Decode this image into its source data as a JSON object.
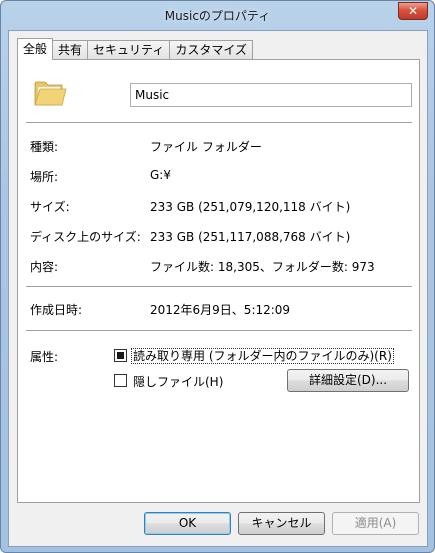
{
  "window": {
    "title": "Musicのプロパティ",
    "close_label": "✕"
  },
  "tabs": [
    {
      "label": "全般",
      "active": true
    },
    {
      "label": "共有",
      "active": false
    },
    {
      "label": "セキュリティ",
      "active": false
    },
    {
      "label": "カスタマイズ",
      "active": false
    }
  ],
  "general": {
    "name_value": "Music",
    "fields": {
      "type_label": "種類:",
      "type_value": "ファイル フォルダー",
      "location_label": "場所:",
      "location_value": "G:¥",
      "size_label": "サイズ:",
      "size_value": "233 GB (251,079,120,118 バイト)",
      "disk_size_label": "ディスク上のサイズ:",
      "disk_size_value": "233 GB (251,117,088,768 バイト)",
      "contents_label": "内容:",
      "contents_value": "ファイル数: 18,305、フォルダー数: 973",
      "created_label": "作成日時:",
      "created_value": "2012年6月9日、5:12:09",
      "attributes_label": "属性:"
    },
    "attributes": {
      "readonly_label": "読み取り専用 (フォルダー内のファイルのみ)(R)",
      "hidden_label": "隠しファイル(H)",
      "advanced_label": "詳細設定(D)..."
    }
  },
  "buttons": {
    "ok": "OK",
    "cancel": "キャンセル",
    "apply": "適用(A)"
  },
  "colors": {
    "folder": "#f2d477",
    "close": "#c0392b",
    "default_button": "#3c7fb1"
  }
}
